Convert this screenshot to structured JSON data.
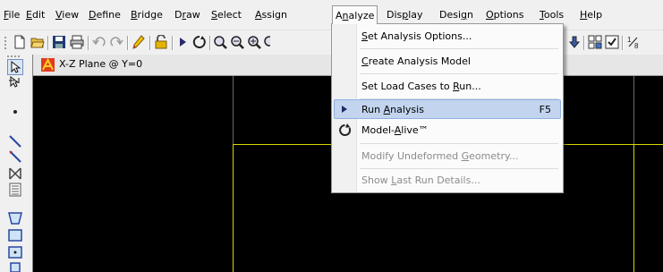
{
  "menubar": {
    "items": [
      {
        "label": "File",
        "u": "F",
        "rest": "ile"
      },
      {
        "label": "Edit",
        "u": "E",
        "rest": "dit"
      },
      {
        "label": "View",
        "u": "V",
        "rest": "iew"
      },
      {
        "label": "Define",
        "u": "D",
        "rest": "efine"
      },
      {
        "label": "Bridge",
        "u": "B",
        "rest": "ridge"
      },
      {
        "label": "Draw",
        "pre": "D",
        "u": "r",
        "rest": "aw"
      },
      {
        "label": "Select",
        "u": "S",
        "rest": "elect"
      },
      {
        "label": "Assign",
        "u": "A",
        "rest": "ssign"
      },
      {
        "label": "Analyze",
        "pre": "A",
        "u": "n",
        "rest": "alyze",
        "active": true
      },
      {
        "label": "Display",
        "pre": "Dis",
        "u": "p",
        "rest": "lay"
      },
      {
        "label": "Design",
        "pre": "Desi",
        "u": "g",
        "rest": "n"
      },
      {
        "label": "Options",
        "u": "O",
        "rest": "ptions"
      },
      {
        "label": "Tools",
        "u": "T",
        "rest": "ools"
      },
      {
        "label": "Help",
        "u": "H",
        "rest": "elp"
      }
    ]
  },
  "window": {
    "title": "X-Z Plane @ Y=0"
  },
  "analyze_menu": {
    "items": [
      {
        "pre": "",
        "u": "S",
        "rest": "et Analysis Options...",
        "shortcut": "",
        "enabled": true
      },
      {
        "pre": "",
        "u": "C",
        "rest": "reate Analysis Model",
        "shortcut": "",
        "enabled": true
      },
      {
        "pre": "Set Load Cases to ",
        "u": "R",
        "rest": "un...",
        "shortcut": "",
        "enabled": true
      },
      {
        "pre": "Run ",
        "u": "A",
        "rest": "nalysis",
        "shortcut": "F5",
        "enabled": true,
        "highlighted": true,
        "icon": "play-arrow-icon"
      },
      {
        "pre": "Model-",
        "u": "A",
        "rest": "live™",
        "shortcut": "",
        "enabled": true,
        "icon": "model-alive-icon"
      },
      {
        "pre": "Modify Undeformed ",
        "u": "G",
        "rest": "eometry...",
        "shortcut": "",
        "enabled": false
      },
      {
        "pre": "Show ",
        "u": "L",
        "rest": "ast Run Details...",
        "shortcut": "",
        "enabled": false
      }
    ]
  },
  "colors": {
    "canvas_bg": "#000000",
    "grid_line": "#d8d800",
    "highlight": "#c2d4ee"
  }
}
